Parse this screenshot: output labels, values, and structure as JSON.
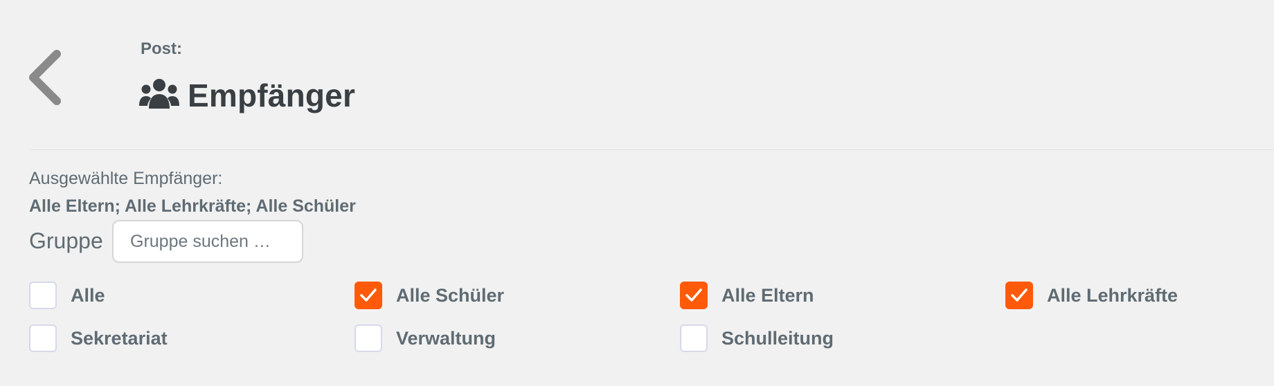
{
  "header": {
    "overline": "Post:",
    "title": "Empfänger",
    "title_icon": "users-icon",
    "back_icon": "chevron-left-icon"
  },
  "selection": {
    "label": "Ausgewählte Empfänger:",
    "value": "Alle Eltern; Alle Lehrkräfte; Alle Schüler"
  },
  "group_filter": {
    "label": "Gruppe",
    "placeholder": "Gruppe suchen …",
    "value": ""
  },
  "options": [
    {
      "label": "Alle",
      "checked": false
    },
    {
      "label": "Alle Schüler",
      "checked": true
    },
    {
      "label": "Alle Eltern",
      "checked": true
    },
    {
      "label": "Alle Lehrkräfte",
      "checked": true
    },
    {
      "label": "Sekretariat",
      "checked": false
    },
    {
      "label": "Verwaltung",
      "checked": false
    },
    {
      "label": "Schulleitung",
      "checked": false
    }
  ],
  "colors": {
    "accent": "#ff5a0a",
    "background": "#f1f1f1",
    "text": "#5f6b73",
    "title": "#3a3f43"
  }
}
